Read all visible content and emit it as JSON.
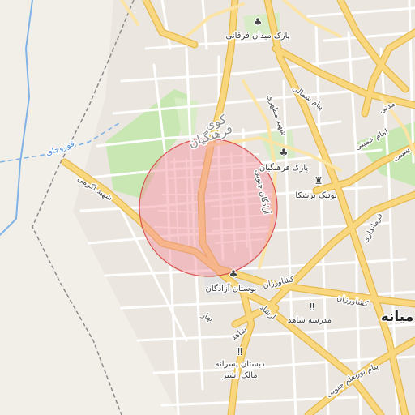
{
  "map": {
    "labels": {
      "park_midan": "پارک میدان فرقانی",
      "park_farhangian": "پارک فرهنگیان",
      "boutique": "بوتیک برشکا",
      "bostan": "بوستان آزادگان",
      "shahed_school": "مدرسه شاهد",
      "dabestan_1": "دبستان پسرانه",
      "dabestan_2": "مالک اشتر",
      "city": "میانه",
      "district_1": "کوی",
      "district_2": "فرهنگیان",
      "canal": "قوروچای",
      "road_ahmad_karimi": "شهید اکرمی",
      "road_azadegan": "آزادگان جنوبی",
      "road_keshavarz_1": "کشاورزان",
      "road_keshavarz_2": "کشاورزان",
      "road_ershad": "ارشاد",
      "road_shahed": "شاهد",
      "road_bahar": "بهار",
      "road_moallem": "معلم جنوبی",
      "road_payam_noor": "پیام نور",
      "road_farmandari": "فرمانداری",
      "road_imam_khomeini": "امام خمینی",
      "road_payam_shomali": "پیام شمالی",
      "road_shahid_motahari": "شهید مطهری",
      "road_madani": "مدنی",
      "road_eastern": "بیست"
    },
    "circle": {
      "fill": "#f28b99",
      "stroke": "#d9534f",
      "opacity": 0.45
    },
    "icons": [
      "tree-icon",
      "tree-icon",
      "shirt-icon",
      "tree-icon",
      "school-icon",
      "school-icon"
    ],
    "colors": {
      "background": "#f2efe9",
      "major_road": "#f9d77e",
      "major_road_casing": "#e6b94f",
      "minor_road": "#ffffff",
      "park": "#c9e7b3",
      "green_area": "#b9dba2",
      "boundary": "#8a8a8a",
      "water": "#7fb2e5"
    }
  }
}
